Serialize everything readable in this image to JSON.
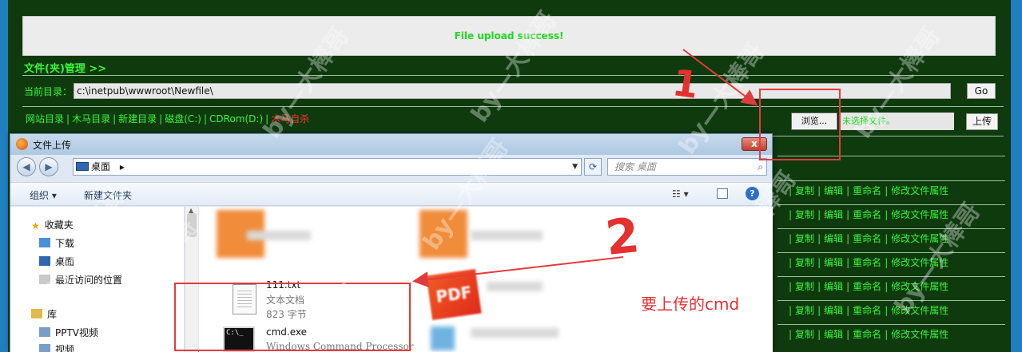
{
  "webshell": {
    "message": "File upload success!",
    "section_title": "文件(夹)管理 >>",
    "current_dir_label": "当前目录：",
    "current_dir_value": "c:\\inetpub\\wwwroot\\Newfile\\",
    "go_label": "Go",
    "nav_links": [
      "网站目录",
      "木马目录",
      "新建目录",
      "磁盘(C:)",
      "CDRom(D:)"
    ],
    "nav_red_link": "木马自杀",
    "browse_label": "浏览...",
    "no_file_label": "未选择文件。",
    "upload_label": "上传",
    "row_actions": [
      "复制",
      "编辑",
      "重命名",
      "修改文件属性"
    ]
  },
  "dialog": {
    "title": "文件上传",
    "close_label": "x",
    "address": "桌面",
    "search_placeholder": "搜索 桌面",
    "organize_label": "组织 ▾",
    "new_folder_label": "新建文件夹",
    "favorites_label": "收藏夹",
    "downloads_label": "下载",
    "desktop_label": "桌面",
    "recent_label": "最近访问的位置",
    "libraries_label": "库",
    "pptv_label": "PPTV视频",
    "video_label": "视频",
    "files": [
      {
        "name": "111.txt",
        "type": "文本文档",
        "size": "823 字节"
      },
      {
        "name": "cmd.exe",
        "type": "Windows Command Processor"
      }
    ]
  },
  "annotations": {
    "step1": "1",
    "step2": "2",
    "note": "要上传的cmd"
  },
  "watermark": "by—大棒哥",
  "colors": {
    "page_bg": "#0e3a0e",
    "accent_green": "#3cf53c",
    "annotation_red": "#e23b3b"
  }
}
